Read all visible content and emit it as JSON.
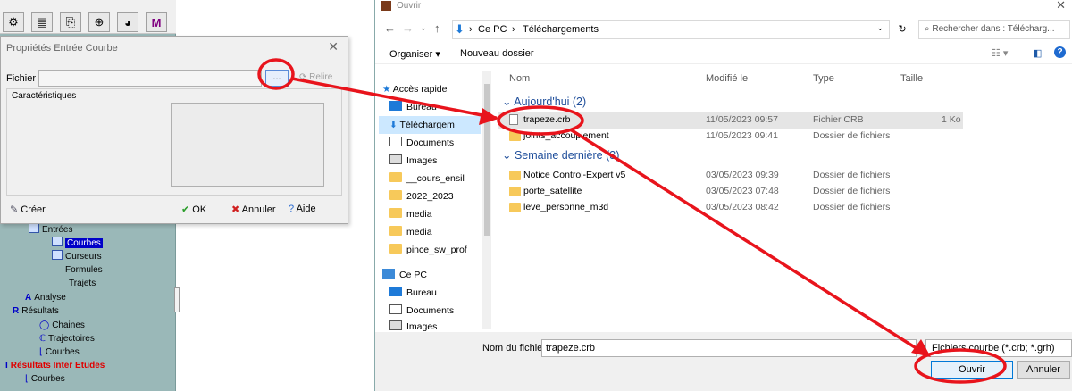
{
  "props": {
    "title": "Propriétés Entrée Courbe",
    "fichier_label": "Fichier",
    "browse_label": "...",
    "relire_label": "Relire",
    "caracteristiques_label": "Caractéristiques",
    "creer_label": "Créer",
    "ok_label": "OK",
    "annuler_label": "Annuler",
    "aide_label": "Aide"
  },
  "tree": {
    "entrees": "Entrées",
    "courbes": "Courbes",
    "curseurs": "Curseurs",
    "formules": "Formules",
    "trajets": "Trajets",
    "analyse": "Analyse",
    "resultats": "Résultats",
    "chaines": "Chaines",
    "trajectoires": "Trajectoires",
    "courbes2": "Courbes",
    "resultats_inter": "Résultats Inter Etudes",
    "courbes3": "Courbes"
  },
  "open": {
    "title": "Ouvrir",
    "breadcrumb": [
      "Ce PC",
      "Téléchargements"
    ],
    "search_placeholder": "Rechercher dans : Télécharg...",
    "organiser": "Organiser ▾",
    "nouveau_dossier": "Nouveau dossier",
    "nav": [
      "Accès rapide",
      "Bureau",
      "Téléchargem",
      "Documents",
      "Images",
      "__cours_ensil",
      "2022_2023",
      "media",
      "media",
      "pince_sw_prof",
      "Ce PC",
      "Bureau",
      "Documents",
      "Images"
    ],
    "columns": {
      "name": "Nom",
      "modified": "Modifié le",
      "type": "Type",
      "size": "Taille"
    },
    "group_today": "Aujourd'hui (2)",
    "group_week": "Semaine dernière (3)",
    "rows": [
      {
        "name": "trapeze.crb",
        "date": "11/05/2023 09:57",
        "type": "Fichier CRB",
        "size": "1 Ko"
      },
      {
        "name": "joints_accouplement",
        "date": "11/05/2023 09:41",
        "type": "Dossier de fichiers",
        "size": ""
      },
      {
        "name": "Notice Control-Expert v5",
        "date": "03/05/2023 09:39",
        "type": "Dossier de fichiers",
        "size": ""
      },
      {
        "name": "porte_satellite",
        "date": "03/05/2023 07:48",
        "type": "Dossier de fichiers",
        "size": ""
      },
      {
        "name": "leve_personne_m3d",
        "date": "03/05/2023 08:42",
        "type": "Dossier de fichiers",
        "size": ""
      }
    ],
    "filename_label": "Nom du fichier :",
    "filename_value": "trapeze.crb",
    "filetype": "Fichiers courbe (*.crb; *.grh)",
    "open_btn": "Ouvrir",
    "cancel_btn": "Annuler"
  },
  "colors": {
    "annotation": "#e8141c",
    "selected": "#cce8ff",
    "accent": "#0078d7"
  }
}
